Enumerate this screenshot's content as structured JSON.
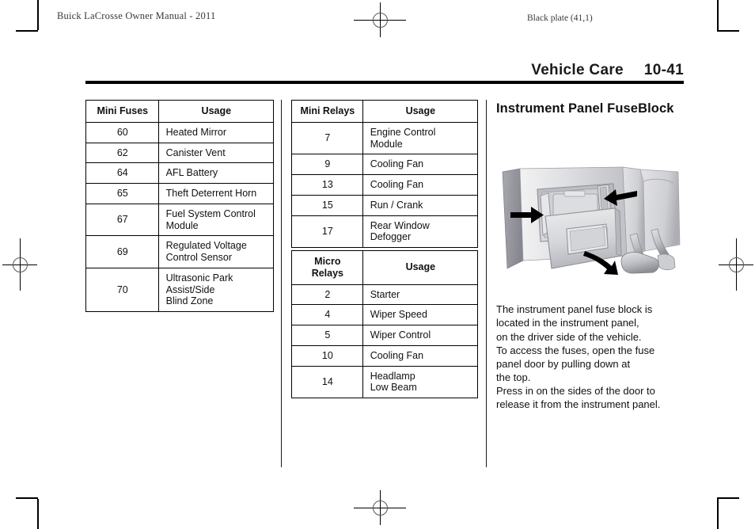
{
  "page": {
    "header_left": "Buick LaCrosse Owner Manual - 2011",
    "plate_label": "Black plate (41,1)",
    "running_head_title": "Vehicle Care",
    "running_head_page": "10-41"
  },
  "tables": [
    {
      "id": "mini-fuses",
      "headers": [
        "Mini Fuses",
        "Usage"
      ],
      "rows": [
        {
          "num": "60",
          "usage": [
            "Heated Mirror"
          ]
        },
        {
          "num": "62",
          "usage": [
            "Canister Vent"
          ]
        },
        {
          "num": "64",
          "usage": [
            "AFL Battery"
          ]
        },
        {
          "num": "65",
          "usage": [
            "Theft Deterrent Horn"
          ]
        },
        {
          "num": "67",
          "usage": [
            "Fuel System Control",
            "Module"
          ]
        },
        {
          "num": "69",
          "usage": [
            "Regulated Voltage",
            "Control Sensor"
          ]
        },
        {
          "num": "70",
          "usage": [
            "Ultrasonic Park",
            "Assist/Side",
            "Blind Zone"
          ]
        }
      ]
    },
    {
      "id": "mini-relays",
      "headers": [
        "Mini Relays",
        "Usage"
      ],
      "rows": [
        {
          "num": "7",
          "usage": [
            "Engine Control",
            "Module"
          ]
        },
        {
          "num": "9",
          "usage": [
            "Cooling Fan"
          ]
        },
        {
          "num": "13",
          "usage": [
            "Cooling Fan"
          ]
        },
        {
          "num": "15",
          "usage": [
            "Run / Crank"
          ]
        },
        {
          "num": "17",
          "usage": [
            "Rear Window",
            "Defogger"
          ]
        }
      ]
    },
    {
      "id": "micro-relays",
      "headers": [
        "Micro\nRelays",
        "Usage"
      ],
      "header_lines": [
        [
          "Micro",
          "Relays"
        ],
        [
          "Usage"
        ]
      ],
      "rows": [
        {
          "num": "2",
          "usage": [
            "Starter"
          ]
        },
        {
          "num": "4",
          "usage": [
            "Wiper Speed"
          ]
        },
        {
          "num": "5",
          "usage": [
            "Wiper Control"
          ]
        },
        {
          "num": "10",
          "usage": [
            "Cooling Fan"
          ]
        },
        {
          "num": "14",
          "usage": [
            "Headlamp",
            "Low Beam"
          ]
        }
      ]
    }
  ],
  "right_column": {
    "section_title_lines": [
      "Instrument Panel Fuse",
      "Block"
    ],
    "figure_name": "instrument-panel-fuse-block-illustration",
    "paragraph_1_lines": [
      "The instrument panel fuse block is",
      "located in the instrument panel,",
      "on the driver side of the vehicle.",
      "To access the fuses, open the fuse",
      "panel door by pulling down at",
      "the top."
    ],
    "paragraph_2_lines": [
      "Press in on the sides of the door to",
      "release it from the instrument panel."
    ]
  },
  "colors": {
    "rule": "#000000",
    "text": "#111111",
    "header_text": "#3a3a3a",
    "panel_light": "#e9e9ea",
    "panel_mid": "#c9cacd",
    "panel_dark": "#9a9ba0",
    "arrow": "#000000"
  }
}
